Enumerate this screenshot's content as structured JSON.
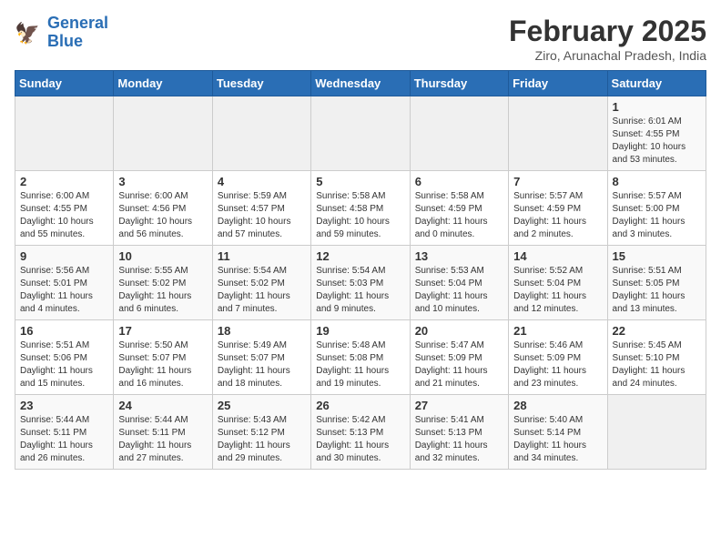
{
  "header": {
    "logo_line1": "General",
    "logo_line2": "Blue",
    "month_title": "February 2025",
    "location": "Ziro, Arunachal Pradesh, India"
  },
  "days_of_week": [
    "Sunday",
    "Monday",
    "Tuesday",
    "Wednesday",
    "Thursday",
    "Friday",
    "Saturday"
  ],
  "weeks": [
    [
      {
        "day": "",
        "info": ""
      },
      {
        "day": "",
        "info": ""
      },
      {
        "day": "",
        "info": ""
      },
      {
        "day": "",
        "info": ""
      },
      {
        "day": "",
        "info": ""
      },
      {
        "day": "",
        "info": ""
      },
      {
        "day": "1",
        "info": "Sunrise: 6:01 AM\nSunset: 4:55 PM\nDaylight: 10 hours\nand 53 minutes."
      }
    ],
    [
      {
        "day": "2",
        "info": "Sunrise: 6:00 AM\nSunset: 4:55 PM\nDaylight: 10 hours\nand 55 minutes."
      },
      {
        "day": "3",
        "info": "Sunrise: 6:00 AM\nSunset: 4:56 PM\nDaylight: 10 hours\nand 56 minutes."
      },
      {
        "day": "4",
        "info": "Sunrise: 5:59 AM\nSunset: 4:57 PM\nDaylight: 10 hours\nand 57 minutes."
      },
      {
        "day": "5",
        "info": "Sunrise: 5:58 AM\nSunset: 4:58 PM\nDaylight: 10 hours\nand 59 minutes."
      },
      {
        "day": "6",
        "info": "Sunrise: 5:58 AM\nSunset: 4:59 PM\nDaylight: 11 hours\nand 0 minutes."
      },
      {
        "day": "7",
        "info": "Sunrise: 5:57 AM\nSunset: 4:59 PM\nDaylight: 11 hours\nand 2 minutes."
      },
      {
        "day": "8",
        "info": "Sunrise: 5:57 AM\nSunset: 5:00 PM\nDaylight: 11 hours\nand 3 minutes."
      }
    ],
    [
      {
        "day": "9",
        "info": "Sunrise: 5:56 AM\nSunset: 5:01 PM\nDaylight: 11 hours\nand 4 minutes."
      },
      {
        "day": "10",
        "info": "Sunrise: 5:55 AM\nSunset: 5:02 PM\nDaylight: 11 hours\nand 6 minutes."
      },
      {
        "day": "11",
        "info": "Sunrise: 5:54 AM\nSunset: 5:02 PM\nDaylight: 11 hours\nand 7 minutes."
      },
      {
        "day": "12",
        "info": "Sunrise: 5:54 AM\nSunset: 5:03 PM\nDaylight: 11 hours\nand 9 minutes."
      },
      {
        "day": "13",
        "info": "Sunrise: 5:53 AM\nSunset: 5:04 PM\nDaylight: 11 hours\nand 10 minutes."
      },
      {
        "day": "14",
        "info": "Sunrise: 5:52 AM\nSunset: 5:04 PM\nDaylight: 11 hours\nand 12 minutes."
      },
      {
        "day": "15",
        "info": "Sunrise: 5:51 AM\nSunset: 5:05 PM\nDaylight: 11 hours\nand 13 minutes."
      }
    ],
    [
      {
        "day": "16",
        "info": "Sunrise: 5:51 AM\nSunset: 5:06 PM\nDaylight: 11 hours\nand 15 minutes."
      },
      {
        "day": "17",
        "info": "Sunrise: 5:50 AM\nSunset: 5:07 PM\nDaylight: 11 hours\nand 16 minutes."
      },
      {
        "day": "18",
        "info": "Sunrise: 5:49 AM\nSunset: 5:07 PM\nDaylight: 11 hours\nand 18 minutes."
      },
      {
        "day": "19",
        "info": "Sunrise: 5:48 AM\nSunset: 5:08 PM\nDaylight: 11 hours\nand 19 minutes."
      },
      {
        "day": "20",
        "info": "Sunrise: 5:47 AM\nSunset: 5:09 PM\nDaylight: 11 hours\nand 21 minutes."
      },
      {
        "day": "21",
        "info": "Sunrise: 5:46 AM\nSunset: 5:09 PM\nDaylight: 11 hours\nand 23 minutes."
      },
      {
        "day": "22",
        "info": "Sunrise: 5:45 AM\nSunset: 5:10 PM\nDaylight: 11 hours\nand 24 minutes."
      }
    ],
    [
      {
        "day": "23",
        "info": "Sunrise: 5:44 AM\nSunset: 5:11 PM\nDaylight: 11 hours\nand 26 minutes."
      },
      {
        "day": "24",
        "info": "Sunrise: 5:44 AM\nSunset: 5:11 PM\nDaylight: 11 hours\nand 27 minutes."
      },
      {
        "day": "25",
        "info": "Sunrise: 5:43 AM\nSunset: 5:12 PM\nDaylight: 11 hours\nand 29 minutes."
      },
      {
        "day": "26",
        "info": "Sunrise: 5:42 AM\nSunset: 5:13 PM\nDaylight: 11 hours\nand 30 minutes."
      },
      {
        "day": "27",
        "info": "Sunrise: 5:41 AM\nSunset: 5:13 PM\nDaylight: 11 hours\nand 32 minutes."
      },
      {
        "day": "28",
        "info": "Sunrise: 5:40 AM\nSunset: 5:14 PM\nDaylight: 11 hours\nand 34 minutes."
      },
      {
        "day": "",
        "info": ""
      }
    ]
  ]
}
